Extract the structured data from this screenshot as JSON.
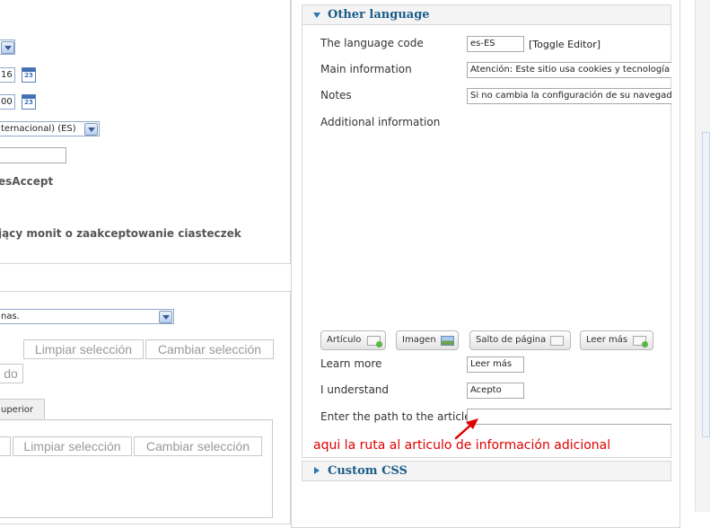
{
  "left": {
    "field_value_suffix": "V",
    "date1_value": "16",
    "date2_value": "00",
    "calendar_day": "23",
    "language_select_value": "ternacional) (ES)",
    "text_input_value": "",
    "cookies_accept_text": "esAccept",
    "monit_text": "jący monit o zaakceptowanie ciasteczek",
    "select2_value": "nas.",
    "clear_selection_label": "Limpiar selección",
    "change_selection_label": "Cambiar selección",
    "do_button_label": "do",
    "tab_label": "uperior",
    "clear_selection_label_2": "Limpiar selección",
    "change_selection_label_2": "Cambiar selección"
  },
  "other_language": {
    "legend": "Other language",
    "language_code_label": "The language code",
    "language_code_value": "es-ES",
    "toggle_editor_label": "[Toggle Editor]",
    "main_information_label": "Main information",
    "main_information_value": "Atención: Este sitio usa cookies y tecnología",
    "notes_label": "Notes",
    "notes_value": "Si no cambia la configuración de su navegad",
    "additional_information_label": "Additional information",
    "editor_buttons": [
      {
        "label": "Artículo",
        "icon": "article-plus-icon"
      },
      {
        "label": "Imagen",
        "icon": "image-icon"
      },
      {
        "label": "Salto de página",
        "icon": "page-break-icon"
      },
      {
        "label": "Leer más",
        "icon": "read-more-icon"
      }
    ],
    "learn_more_label": "Learn more",
    "learn_more_value": "Leer más",
    "understand_label": "I understand",
    "understand_value": "Acepto",
    "path_label": "Enter the path to the article",
    "path_value": "",
    "annotation_text": "aqui la ruta al articulo de información adicional",
    "annotation_color": "#e00000"
  },
  "custom_css": {
    "legend": "Custom CSS"
  },
  "colors": {
    "legend_text": "#1b5c8a",
    "toggle_icon": "#2a79b5"
  }
}
